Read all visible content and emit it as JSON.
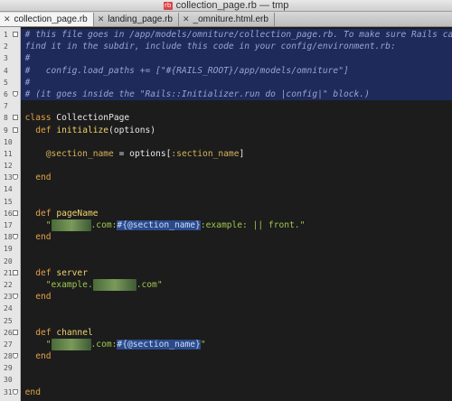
{
  "window": {
    "title": "collection_page.rb — tmp",
    "icon_label": "rb"
  },
  "tabs": [
    {
      "label": "collection_page.rb",
      "active": true
    },
    {
      "label": "landing_page.rb",
      "active": false
    },
    {
      "label": "_omniture.html.erb",
      "active": false
    }
  ],
  "lines": [
    {
      "num": "1",
      "text": "# this file goes in /app/models/omniture/collection_page.rb. To make sure Rails can"
    },
    {
      "num": "2",
      "text": "find it in the subdir, include this code in your config/environment.rb:"
    },
    {
      "num": "3",
      "text": "#"
    },
    {
      "num": "4",
      "text": "#   config.load_paths += [\"#{RAILS_ROOT}/app/models/omniture\"]"
    },
    {
      "num": "5",
      "text": "#"
    },
    {
      "num": "6",
      "text": "# (it goes inside the \"Rails::Initializer.run do |config|\" block.)"
    },
    {
      "num": "7",
      "text": ""
    },
    {
      "num": "8",
      "kw": "class",
      "rest": " CollectionPage"
    },
    {
      "num": "9",
      "kw": "def",
      "fn": "initialize",
      "rest": "(options)"
    },
    {
      "num": "10",
      "text": ""
    },
    {
      "num": "11",
      "iv": "@section_name",
      "mid": " = options[",
      "sym": ":section_name",
      "end": "]"
    },
    {
      "num": "12",
      "text": ""
    },
    {
      "num": "13",
      "kw": "end"
    },
    {
      "num": "14",
      "text": ""
    },
    {
      "num": "15",
      "text": ""
    },
    {
      "num": "16",
      "kw": "def",
      "fn": "pageName"
    },
    {
      "num": "17",
      "str_a": "\"",
      "str_b": ".com:",
      "interp": "#{@section_name}",
      "str_c": ":example: || front.\""
    },
    {
      "num": "18",
      "kw": "end"
    },
    {
      "num": "19",
      "text": ""
    },
    {
      "num": "20",
      "text": ""
    },
    {
      "num": "21",
      "kw": "def",
      "fn": "server"
    },
    {
      "num": "22",
      "str_a": "\"example.",
      "str_c": ".com\""
    },
    {
      "num": "23",
      "kw": "end"
    },
    {
      "num": "24",
      "text": ""
    },
    {
      "num": "25",
      "text": ""
    },
    {
      "num": "26",
      "kw": "def",
      "fn": "channel"
    },
    {
      "num": "27",
      "str_a": "\"",
      "str_b": ".com:",
      "interp": "#{@section_name}",
      "str_c": "\""
    },
    {
      "num": "28",
      "kw": "end"
    },
    {
      "num": "29",
      "text": ""
    },
    {
      "num": "30",
      "text": ""
    },
    {
      "num": "31",
      "kw": "end"
    }
  ],
  "colors": {
    "background": "#1c1c1c",
    "comment_bg": "#1e2a5a",
    "keyword": "#e1a24a",
    "string": "#9fc74c"
  }
}
